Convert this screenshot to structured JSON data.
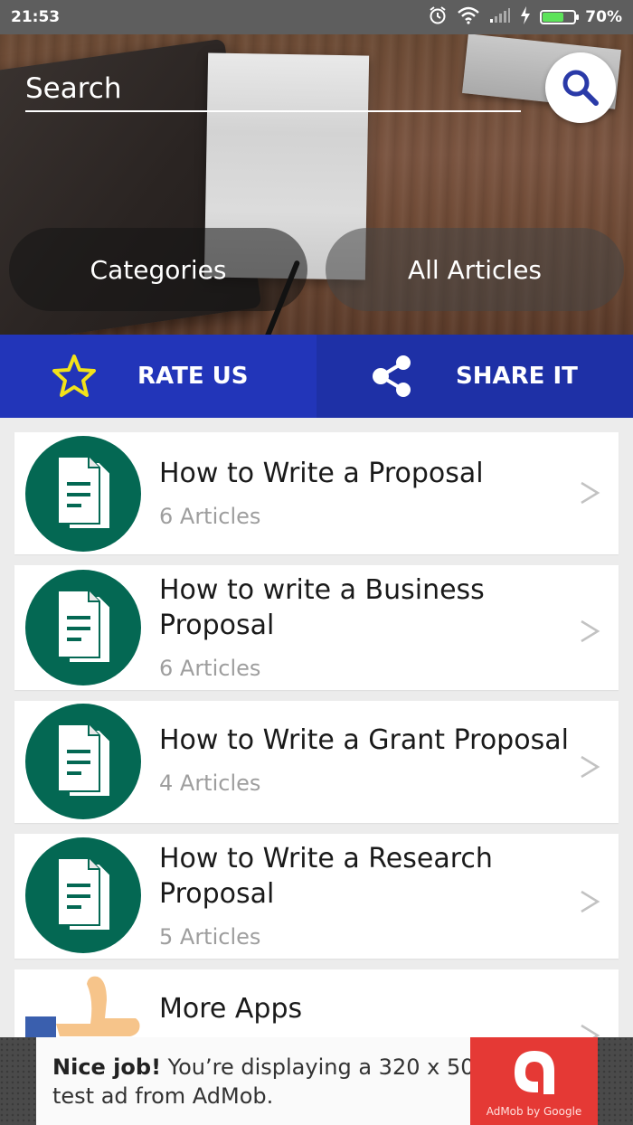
{
  "status_bar": {
    "time": "21:53",
    "battery_percent": "70%",
    "battery_level": 0.7,
    "icons": [
      "alarm-icon",
      "wifi-icon",
      "signal-icon",
      "charging-icon",
      "battery-icon"
    ]
  },
  "header": {
    "search_placeholder": "Search",
    "categories_label": "Categories",
    "all_articles_label": "All Articles"
  },
  "actions": {
    "rate_label": "RATE US",
    "share_label": "SHARE IT"
  },
  "list": {
    "items": [
      {
        "title": "How to Write a Proposal",
        "subtitle": "6 Articles",
        "icon": "document-icon"
      },
      {
        "title": "How to write a Business Proposal",
        "subtitle": "6 Articles",
        "icon": "document-icon"
      },
      {
        "title": "How to Write a Grant Proposal",
        "subtitle": "4 Articles",
        "icon": "document-icon"
      },
      {
        "title": "How to Write a Research Proposal",
        "subtitle": "5 Articles",
        "icon": "document-icon"
      },
      {
        "title": "More Apps",
        "subtitle": "",
        "icon": "thumbs-up-icon"
      }
    ]
  },
  "ad": {
    "bold_text": "Nice job!",
    "line1_rest": " You’re displaying a 320 x 50",
    "line2": "test ad from AdMob.",
    "logo_text": "AdMob by Google"
  },
  "colors": {
    "action_bar": "#2235b9",
    "avatar_green": "#046853",
    "ad_red": "#e53935",
    "star_yellow": "#f2e21a"
  }
}
